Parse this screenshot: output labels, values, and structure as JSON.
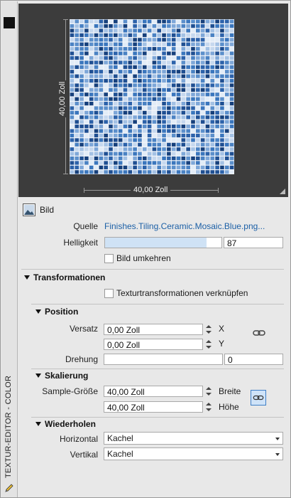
{
  "panel": {
    "title": "TEXTUR-EDITOR - COLOR"
  },
  "preview": {
    "width_label": "40,00 Zoll",
    "height_label": "40,00 Zoll"
  },
  "image": {
    "header": "Bild",
    "source_label": "Quelle",
    "source_value": "Finishes.Tiling.Ceramic.Mosaic.Blue.png...",
    "brightness_label": "Helligkeit",
    "brightness_value": "87",
    "brightness_fraction": 0.87,
    "invert_label": "Bild umkehren"
  },
  "transformations": {
    "header": "Transformationen",
    "link_label": "Texturtransformationen verknüpfen"
  },
  "position": {
    "header": "Position",
    "offset_label": "Versatz",
    "offset_x": "0,00 Zoll",
    "x_axis": "X",
    "offset_y": "0,00 Zoll",
    "y_axis": "Y",
    "rotation_label": "Drehung",
    "rotation_value": "0"
  },
  "scaling": {
    "header": "Skalierung",
    "sample_label": "Sample-Größe",
    "width_value": "40,00 Zoll",
    "width_label": "Breite",
    "height_value": "40,00 Zoll",
    "height_label": "Höhe"
  },
  "repeat": {
    "header": "Wiederholen",
    "horizontal_label": "Horizontal",
    "horizontal_value": "Kachel",
    "vertical_label": "Vertikal",
    "vertical_value": "Kachel"
  }
}
